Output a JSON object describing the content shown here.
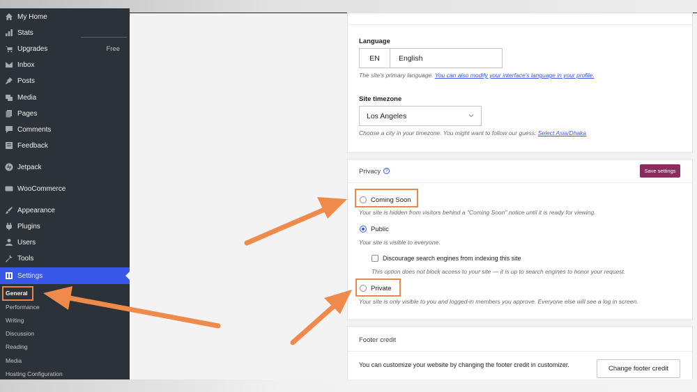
{
  "sidebar": {
    "items": [
      {
        "label": "My Home",
        "icon": "home-icon"
      },
      {
        "label": "Stats",
        "icon": "stats-icon"
      },
      {
        "label": "Upgrades",
        "icon": "cart-icon",
        "badge": "Free"
      },
      {
        "label": "Inbox",
        "icon": "inbox-icon"
      },
      {
        "label": "Posts",
        "icon": "pin-icon"
      },
      {
        "label": "Media",
        "icon": "media-icon"
      },
      {
        "label": "Pages",
        "icon": "pages-icon"
      },
      {
        "label": "Comments",
        "icon": "comment-icon"
      },
      {
        "label": "Feedback",
        "icon": "feedback-icon"
      },
      {
        "label": "Jetpack",
        "icon": "jetpack-icon"
      },
      {
        "label": "WooCommerce",
        "icon": "woo-icon"
      },
      {
        "label": "Appearance",
        "icon": "brush-icon"
      },
      {
        "label": "Plugins",
        "icon": "plugin-icon"
      },
      {
        "label": "Users",
        "icon": "user-icon"
      },
      {
        "label": "Tools",
        "icon": "wrench-icon"
      },
      {
        "label": "Settings",
        "icon": "settings-icon"
      }
    ],
    "submenu": [
      "General",
      "Performance",
      "Writing",
      "Discussion",
      "Reading",
      "Media",
      "Hosting Configuration"
    ]
  },
  "language": {
    "label": "Language",
    "code": "EN",
    "name": "English",
    "hint": "The site's primary language.",
    "hint_link": "You can also modify your interface's language in your profile."
  },
  "timezone": {
    "label": "Site timezone",
    "value": "Los Angeles",
    "hint": "Choose a city in your timezone. You might want to follow our guess:",
    "hint_link": "Select Asia/Dhaka"
  },
  "privacy": {
    "title": "Privacy",
    "save_label": "Save settings",
    "coming_soon_label": "Coming Soon",
    "coming_soon_desc": "Your site is hidden from visitors behind a \"Coming Soon\" notice until it is ready for viewing.",
    "public_label": "Public",
    "public_desc": "Your site is visible to everyone.",
    "discourage_label": "Discourage search engines from indexing this site",
    "discourage_desc": "This option does not block access to your site — it is up to search engines to honor your request.",
    "private_label": "Private",
    "private_desc": "Your site is only visible to you and logged-in members you approve. Everyone else will see a log in screen.",
    "selected": "Public"
  },
  "footer_credit": {
    "title": "Footer credit",
    "text": "You can customize your website by changing the footer credit in customizer.",
    "button_label": "Change footer credit"
  },
  "colors": {
    "accent": "#3858e9",
    "save": "#8a2c5f",
    "highlight": "#e8874a",
    "sidebar": "#2c3338"
  }
}
